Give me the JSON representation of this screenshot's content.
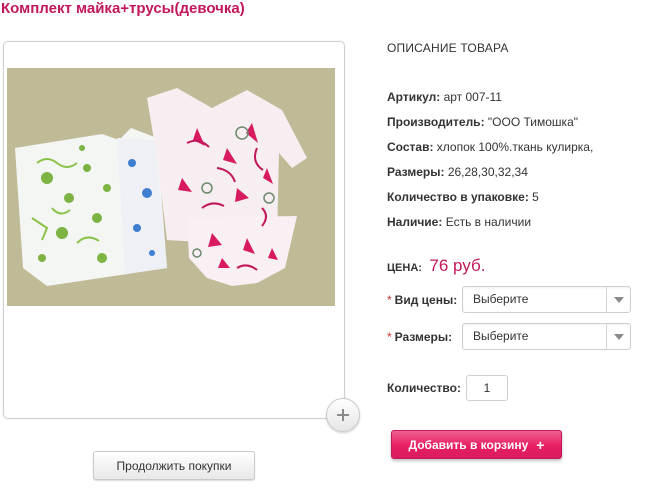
{
  "product": {
    "title": "Комплект майка+трусы(девочка)"
  },
  "description": {
    "section_title": "ОПИСАНИЕ ТОВАРА",
    "specs": [
      {
        "label": "Артикул:",
        "value": "арт 007-11"
      },
      {
        "label": "Производитель:",
        "value": "\"ООО Тимошка\""
      },
      {
        "label": "Состав:",
        "value": "хлопок 100%.ткань кулирка,"
      },
      {
        "label": "Размеры:",
        "value": "26,28,30,32,34"
      },
      {
        "label": "Количество в упаковке:",
        "value": "5"
      },
      {
        "label": "Наличие:",
        "value": "Есть в наличии"
      }
    ]
  },
  "price": {
    "label": "ЦЕНА:",
    "value": "76 руб."
  },
  "options": {
    "required_mark": "*",
    "price_type_label": "Вид цены:",
    "price_type_value": "Выберите",
    "sizes_label": "Размеры:",
    "sizes_value": "Выберите"
  },
  "quantity": {
    "label": "Количество:",
    "value": "1"
  },
  "buttons": {
    "add_to_cart": "Добавить в корзину",
    "add_to_cart_icon": "+",
    "continue_shopping": "Продолжить покупки"
  },
  "icons": {
    "zoom": "plus-icon",
    "dropdown": "chevron-down-icon"
  },
  "colors": {
    "accent": "#c2185b",
    "cart_button": "#e91e63"
  }
}
